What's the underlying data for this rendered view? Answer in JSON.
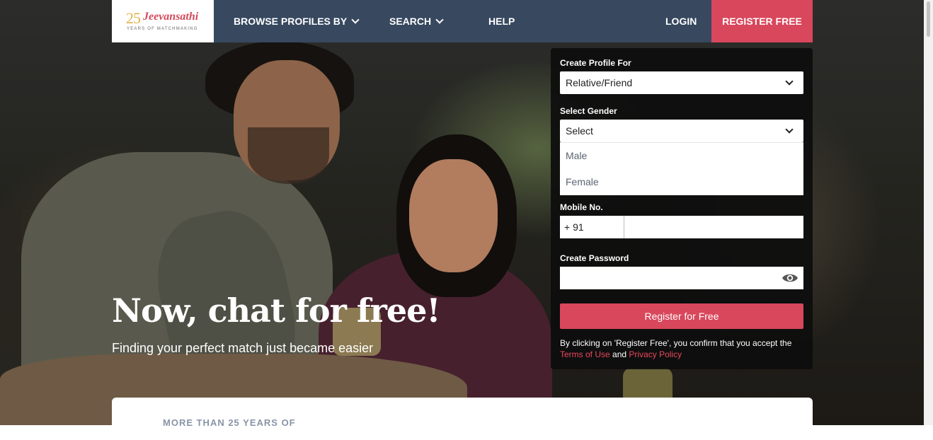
{
  "header": {
    "logo_number": "25",
    "logo_name": "Jeevansathi",
    "logo_tagline": "YEARS OF MATCHMAKING",
    "nav": {
      "browse": "BROWSE PROFILES BY",
      "search": "SEARCH",
      "help": "HELP",
      "login": "LOGIN",
      "register": "REGISTER FREE"
    }
  },
  "hero": {
    "title": "Now, chat for free!",
    "subtitle": "Finding your perfect match just became easier"
  },
  "form": {
    "profile_for_label": "Create Profile For",
    "profile_for_value": "Relative/Friend",
    "gender_label": "Select Gender",
    "gender_value": "Select",
    "gender_options": [
      "Male",
      "Female"
    ],
    "mobile_label": "Mobile No.",
    "country_code": "+ 91",
    "mobile_value": "",
    "password_label": "Create Password",
    "password_value": "",
    "register_button": "Register for Free",
    "terms_prefix": "By clicking on 'Register Free', you confirm that you accept the",
    "terms_link": "Terms of Use",
    "terms_and": "and",
    "privacy_link": "Privacy Policy"
  },
  "card": {
    "text": "MORE THAN 25 YEARS OF"
  },
  "icons": {
    "dropdown": "chevron-down-icon",
    "password_toggle": "eye-icon"
  },
  "colors": {
    "brand_accent": "#d9475c",
    "header_bg": "#384a62",
    "panel_bg": "#0e0e0e"
  }
}
